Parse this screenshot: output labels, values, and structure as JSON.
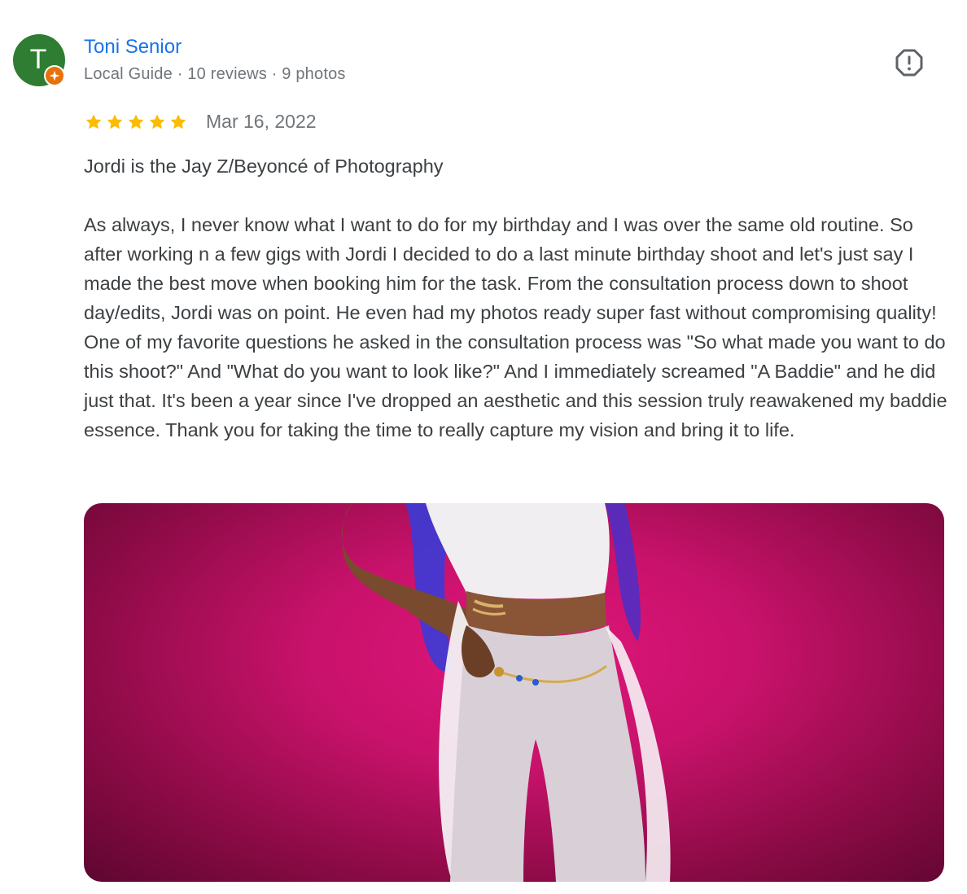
{
  "reviewer": {
    "initial": "T",
    "name": "Toni Senior",
    "meta": "Local Guide · 10 reviews · 9 photos",
    "avatar_color": "#2e7d32",
    "badge_color": "#e8710a",
    "badge_icon": "local-guide-star-icon"
  },
  "actions": {
    "flag_icon": "report-flag-icon"
  },
  "review": {
    "rating": 5,
    "date": "Mar 16, 2022",
    "headline": "Jordi is the Jay Z/Beyoncé of Photography",
    "text": "As always, I never know what I want to do for my birthday and I was over the same old routine. So after working n a few gigs with Jordi I decided to do a last minute birthday shoot and let's just say I made the best move when booking him for the task. From the consultation process down to shoot day/edits, Jordi was on point. He even had my photos ready super fast without compromising quality! One of my favorite questions he asked in the consultation process was \"So what made you want to do this shoot?\" And \"What do you want to look like?\" And I immediately screamed \"A Baddie\" and he did just that. It's been a year since I've dropped an aesthetic and this session truly reawakened my baddie essence. Thank you for taking the time to really capture my vision and bring it to life."
  },
  "colors": {
    "name_link": "#1a73e8",
    "star": "#fbbc04",
    "photo_background": "#c8126b"
  }
}
